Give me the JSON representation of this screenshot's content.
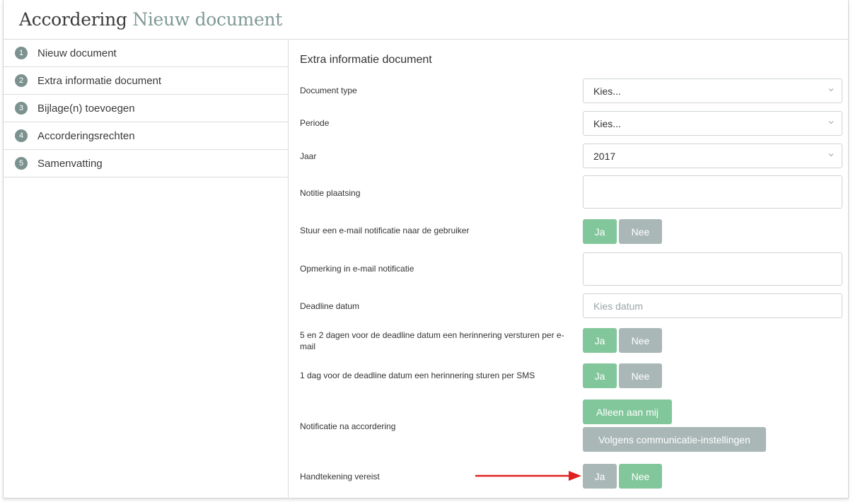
{
  "header": {
    "title": "Accordering",
    "subtitle": "Nieuw document"
  },
  "sidebar": {
    "items": [
      {
        "num": "1",
        "label": "Nieuw document"
      },
      {
        "num": "2",
        "label": "Extra informatie document"
      },
      {
        "num": "3",
        "label": "Bijlage(n) toevoegen"
      },
      {
        "num": "4",
        "label": "Accorderingsrechten"
      },
      {
        "num": "5",
        "label": "Samenvatting"
      }
    ]
  },
  "form": {
    "title": "Extra informatie document",
    "document_type": {
      "label": "Document type",
      "value": "Kies..."
    },
    "periode": {
      "label": "Periode",
      "value": "Kies..."
    },
    "jaar": {
      "label": "Jaar",
      "value": "2017"
    },
    "notitie": {
      "label": "Notitie plaatsing",
      "value": ""
    },
    "email_notificatie": {
      "label": "Stuur een e-mail notificatie naar de gebruiker",
      "yes": "Ja",
      "no": "Nee",
      "selected": "Ja"
    },
    "opmerking": {
      "label": "Opmerking in e-mail notificatie",
      "value": ""
    },
    "deadline": {
      "label": "Deadline datum",
      "placeholder": "Kies datum"
    },
    "herinnering_email": {
      "label": "5 en 2 dagen voor de deadline datum een herinnering versturen per e-mail",
      "yes": "Ja",
      "no": "Nee",
      "selected": "Ja"
    },
    "herinnering_sms": {
      "label": "1 dag voor de deadline datum een herinnering sturen per SMS",
      "yes": "Ja",
      "no": "Nee",
      "selected": "Ja"
    },
    "notificatie_na": {
      "label": "Notificatie na accordering",
      "option1": "Alleen aan mij",
      "option2": "Volgens communicatie-instellingen",
      "selected": "Alleen aan mij"
    },
    "handtekening": {
      "label": "Handtekening vereist",
      "yes": "Ja",
      "no": "Nee",
      "selected": "Nee"
    }
  },
  "colors": {
    "selected": "#82c79b",
    "unselected": "#a9b8b6",
    "step_badge": "#7c928f",
    "arrow": "#e02020"
  }
}
